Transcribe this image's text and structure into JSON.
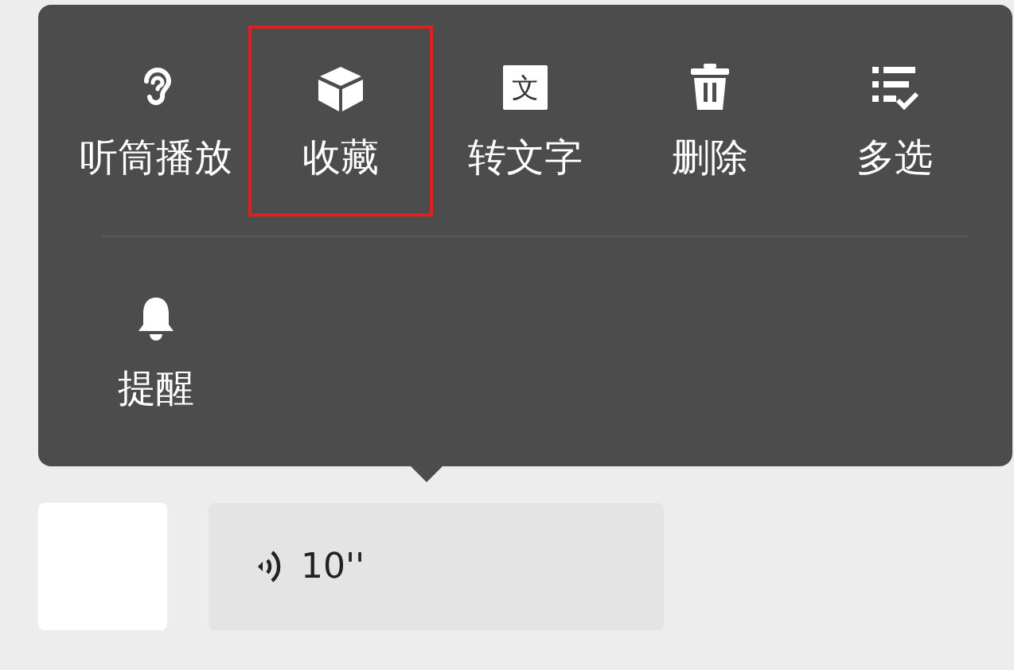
{
  "menu": {
    "rows": [
      [
        {
          "kind": "speaker",
          "label": "听筒播放",
          "selected": false
        },
        {
          "kind": "favorite",
          "label": "收藏",
          "selected": true
        },
        {
          "kind": "transcribe",
          "label": "转文字",
          "icon_text": "文",
          "selected": false
        },
        {
          "kind": "delete",
          "label": "删除",
          "selected": false
        },
        {
          "kind": "multiselect",
          "label": "多选",
          "selected": false
        }
      ],
      [
        {
          "kind": "remind",
          "label": "提醒",
          "selected": false
        }
      ]
    ]
  },
  "message": {
    "duration": "10''"
  }
}
